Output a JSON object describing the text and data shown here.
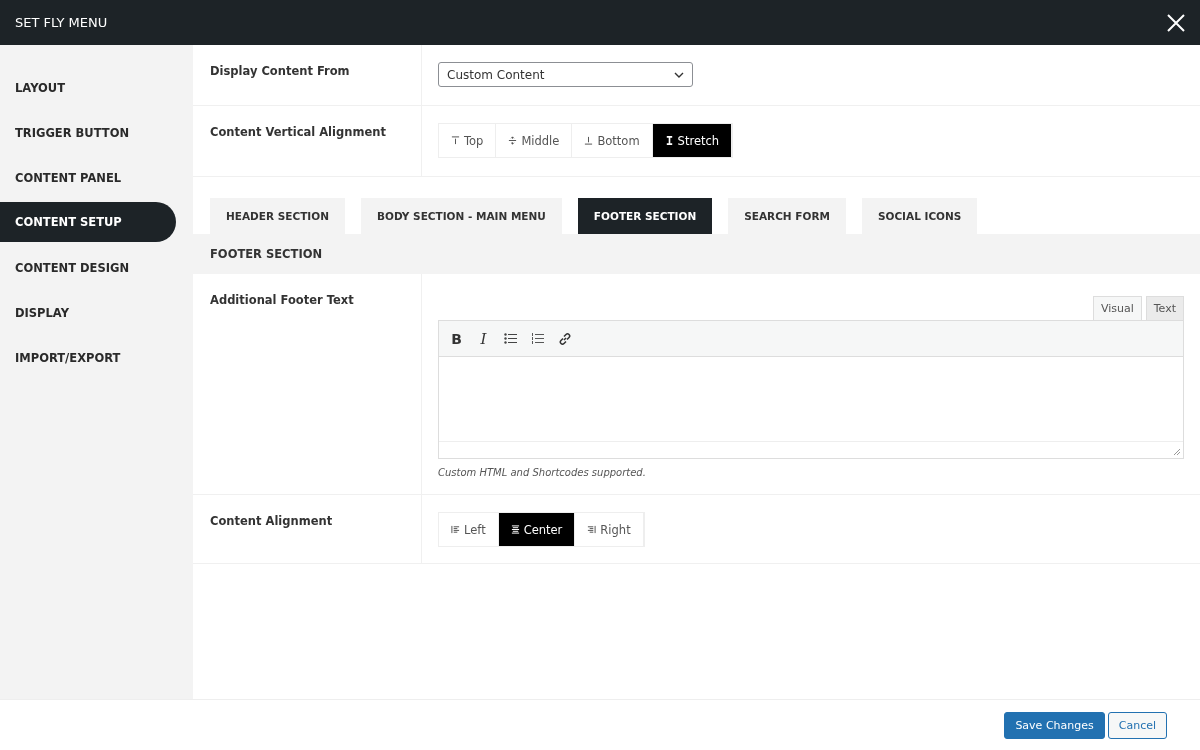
{
  "window": {
    "title": "SET FLY MENU"
  },
  "sidebar": {
    "items": [
      {
        "label": "LAYOUT",
        "selected": false
      },
      {
        "label": "TRIGGER BUTTON",
        "selected": false
      },
      {
        "label": "CONTENT PANEL",
        "selected": false
      },
      {
        "label": "CONTENT SETUP",
        "selected": true
      },
      {
        "label": "CONTENT DESIGN",
        "selected": false
      },
      {
        "label": "DISPLAY",
        "selected": false
      },
      {
        "label": "IMPORT/EXPORT",
        "selected": false
      }
    ]
  },
  "display_content_from": {
    "label": "Display Content From",
    "value": "Custom Content"
  },
  "vertical_alignment": {
    "label": "Content Vertical Alignment",
    "options": [
      {
        "label": "Top",
        "kind": "top",
        "selected": false
      },
      {
        "label": "Middle",
        "kind": "middle",
        "selected": false
      },
      {
        "label": "Bottom",
        "kind": "bottom",
        "selected": false
      },
      {
        "label": "Stretch",
        "kind": "stretch",
        "selected": true
      }
    ]
  },
  "section_tabs": [
    {
      "label": "HEADER SECTION",
      "selected": false
    },
    {
      "label": "BODY SECTION - MAIN MENU",
      "selected": false
    },
    {
      "label": "FOOTER SECTION",
      "selected": true
    },
    {
      "label": "SEARCH FORM",
      "selected": false
    },
    {
      "label": "SOCIAL ICONS",
      "selected": false
    }
  ],
  "section_heading": "FOOTER SECTION",
  "footer_text": {
    "label": "Additional Footer Text",
    "editor_tabs": [
      {
        "label": "Visual",
        "selected": true
      },
      {
        "label": "Text",
        "selected": false
      }
    ],
    "toolbar": [
      {
        "kind": "bold",
        "label": "B"
      },
      {
        "kind": "italic",
        "label": "I"
      },
      {
        "kind": "bullets"
      },
      {
        "kind": "numbers"
      },
      {
        "kind": "link"
      }
    ],
    "help": "Custom HTML and Shortcodes supported."
  },
  "content_alignment": {
    "label": "Content Alignment",
    "options": [
      {
        "label": "Left",
        "kind": "left",
        "selected": false
      },
      {
        "label": "Center",
        "kind": "center",
        "selected": true
      },
      {
        "label": "Right",
        "kind": "right",
        "selected": false
      }
    ]
  },
  "buttons": [
    {
      "label": "Save Changes",
      "kind": "primary"
    },
    {
      "label": "Cancel",
      "kind": "secondary"
    }
  ]
}
